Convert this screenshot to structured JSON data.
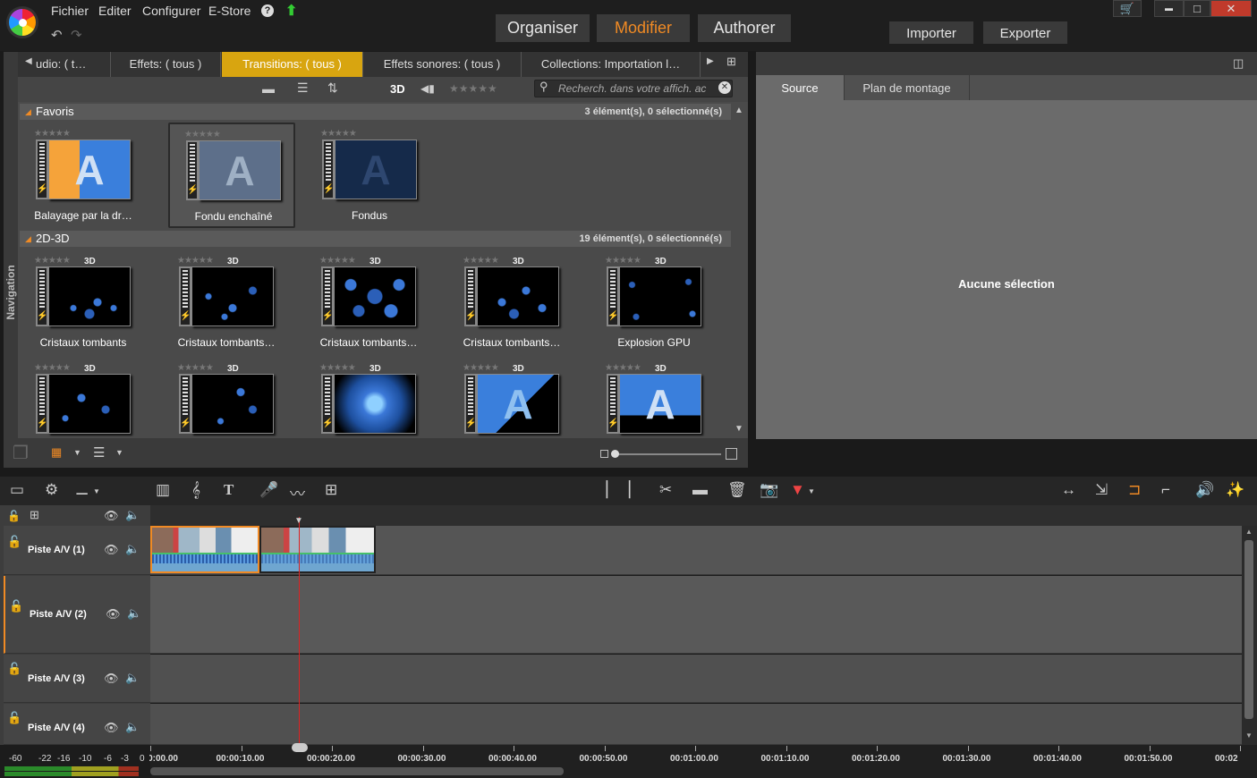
{
  "menu": {
    "items": [
      "Fichier",
      "Editer",
      "Configurer",
      "E-Store"
    ],
    "help_icon": "?",
    "update_icon": "up-arrow-icon"
  },
  "modes": {
    "organiser": "Organiser",
    "modifier": "Modifier",
    "authorer": "Authorer",
    "active": "Modifier"
  },
  "actions": {
    "importer": "Importer",
    "exporter": "Exporter"
  },
  "window_controls": {
    "minimize": "▬",
    "maximize": "□",
    "close": "✕"
  },
  "library": {
    "tabs": [
      "udio: ( t…",
      "Effets: ( tous )",
      "Transitions: ( tous )",
      "Effets sonores: ( tous )",
      "Collections: Importation l…"
    ],
    "active_tab": "Transitions: ( tous )",
    "view_3d": "3D",
    "search_placeholder": "Recherch. dans votre affich. ac",
    "navigation_label": "Navigation",
    "sections": [
      {
        "title": "Favoris",
        "count": "3 élément(s), 0 sélectionné(s)",
        "items": [
          {
            "caption": "Balayage par la dr…",
            "badge": ""
          },
          {
            "caption": "Fondu enchaîné",
            "badge": ""
          },
          {
            "caption": "Fondus",
            "badge": ""
          }
        ]
      },
      {
        "title": "2D-3D",
        "count": "19 élément(s), 0 sélectionné(s)",
        "items": [
          {
            "caption": "Cristaux tombants",
            "badge": "3D"
          },
          {
            "caption": "Cristaux tombants…",
            "badge": "3D"
          },
          {
            "caption": "Cristaux tombants…",
            "badge": "3D"
          },
          {
            "caption": "Cristaux tombants…",
            "badge": "3D"
          },
          {
            "caption": "Explosion GPU",
            "badge": "3D"
          },
          {
            "caption": "",
            "badge": "3D"
          },
          {
            "caption": "",
            "badge": "3D"
          },
          {
            "caption": "",
            "badge": "3D"
          },
          {
            "caption": "",
            "badge": "3D"
          },
          {
            "caption": "",
            "badge": "3D"
          }
        ]
      }
    ],
    "stars": "★★★★★"
  },
  "preview": {
    "tabs": [
      "Source",
      "Plan de montage"
    ],
    "active_tab": "Source",
    "empty_message": "Aucune sélection"
  },
  "timeline": {
    "tracks": [
      {
        "label": "Piste A/V (1)"
      },
      {
        "label": "Piste A/V (2)"
      },
      {
        "label": "Piste A/V (3)"
      },
      {
        "label": "Piste A/V (4)"
      }
    ],
    "ruler": [
      "00:00:00.00",
      "00:00:10.00",
      "00:00:20.00",
      "00:00:30.00",
      "00:00:40.00",
      "00:00:50.00",
      "00:01:00.00",
      "00:01:10.00",
      "00:01:20.00",
      "00:01:30.00",
      "00:01:40.00",
      "00:01:50.00",
      "00:02"
    ],
    "meter_labels": [
      "-60",
      "-22",
      "-16",
      "-10",
      "-6",
      "-3",
      "0"
    ]
  },
  "colors": {
    "accent": "#f08a24",
    "active_tab": "#d8a510",
    "playhead": "#dd2222"
  }
}
